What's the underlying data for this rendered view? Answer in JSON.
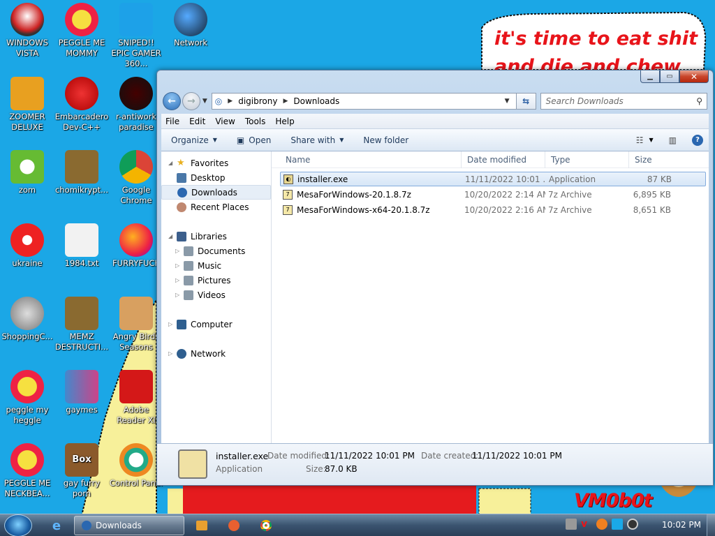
{
  "desktop": {
    "icons": [
      {
        "label": "WINDOWS VISTA",
        "icon": "windows-vista-icon"
      },
      {
        "label": "PEGGLE ME MOMMY",
        "icon": "peggle-icon"
      },
      {
        "label": "SNIPED!! EPIC GAMER 360...",
        "icon": "skype-icon"
      },
      {
        "label": "Network",
        "icon": "network-icon"
      },
      {
        "label": "ZOOMER DELUXE",
        "icon": "zoomer-icon"
      },
      {
        "label": "Embarcadero Dev-C++",
        "icon": "devcpp-icon"
      },
      {
        "label": "r-antiwork paradise",
        "icon": "antiwork-icon"
      },
      {
        "label": "zom",
        "icon": "zombie-flower-icon"
      },
      {
        "label": "chomikrypt...",
        "icon": "chomikrypt-icon"
      },
      {
        "label": "Google Chrome",
        "icon": "chrome-icon"
      },
      {
        "label": "ukraine",
        "icon": "radiation-icon"
      },
      {
        "label": "1984.txt",
        "icon": "text-file-icon"
      },
      {
        "label": "FURRYFUCK",
        "icon": "firefox-icon"
      },
      {
        "label": "ShoppingC...",
        "icon": "flash-icon"
      },
      {
        "label": "MEMZ DESTRUCTI...",
        "icon": "memz-icon"
      },
      {
        "label": "Angry Birds Seasons",
        "icon": "angry-birds-icon"
      },
      {
        "label": "peggle my heggle",
        "icon": "peggle-icon"
      },
      {
        "label": "gaymes",
        "icon": "gaymes-icon"
      },
      {
        "label": "Adobe Reader XI",
        "icon": "adobe-reader-icon"
      },
      {
        "label": "PEGGLE ME NECKBEA...",
        "icon": "peggle-icon"
      },
      {
        "label": "gay furry porn",
        "icon": "box-icon"
      },
      {
        "label": "Control Panel",
        "icon": "control-panel-icon"
      }
    ],
    "speech_bubble": "it's time to eat shit\nand die and chew",
    "watermark": "VM0b0t",
    "box_icon_text": "Box"
  },
  "explorer": {
    "breadcrumb": [
      "digibrony",
      "Downloads"
    ],
    "search_placeholder": "Search Downloads",
    "menu": [
      "File",
      "Edit",
      "View",
      "Tools",
      "Help"
    ],
    "toolbar": {
      "organize": "Organize",
      "open": "Open",
      "share_with": "Share with",
      "new_folder": "New folder"
    },
    "nav_pane": {
      "favorites": "Favorites",
      "favorites_items": [
        "Desktop",
        "Downloads",
        "Recent Places"
      ],
      "libraries": "Libraries",
      "libraries_items": [
        "Documents",
        "Music",
        "Pictures",
        "Videos"
      ],
      "computer": "Computer",
      "network": "Network"
    },
    "columns": [
      "Name",
      "Date modified",
      "Type",
      "Size"
    ],
    "files": [
      {
        "name": "installer.exe",
        "date": "11/11/2022 10:01 ...",
        "type": "Application",
        "size": "87 KB"
      },
      {
        "name": "MesaForWindows-20.1.8.7z",
        "date": "10/20/2022 2:14 AM",
        "type": "7z Archive",
        "size": "6,895 KB"
      },
      {
        "name": "MesaForWindows-x64-20.1.8.7z",
        "date": "10/20/2022 2:16 AM",
        "type": "7z Archive",
        "size": "8,651 KB"
      }
    ],
    "details": {
      "name": "installer.exe",
      "type": "Application",
      "date_modified_label": "Date modified:",
      "date_modified": "11/11/2022 10:01 PM",
      "date_created_label": "Date created:",
      "date_created": "11/11/2022 10:01 PM",
      "size_label": "Size:",
      "size": "87.0 KB"
    }
  },
  "taskbar": {
    "active_window": "Downloads",
    "clock": "10:02 PM"
  },
  "colors": {
    "desktop": "#1ba7e6",
    "bubble_text": "#e8141a",
    "selection": "#84acdd"
  }
}
